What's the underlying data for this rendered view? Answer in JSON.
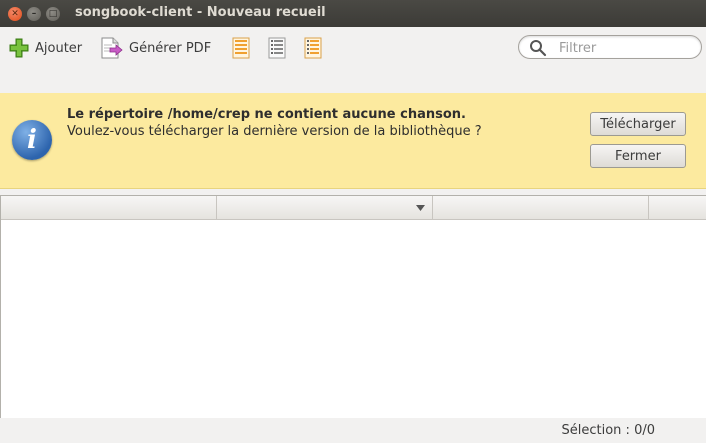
{
  "window": {
    "title": "songbook-client - Nouveau recueil"
  },
  "toolbar": {
    "add_label": "Ajouter",
    "pdf_label": "Générer PDF",
    "list_icons": [
      "list-orange-icon",
      "list-plain-icon",
      "list-mixed-icon"
    ]
  },
  "search": {
    "placeholder": "Filtrer",
    "value": ""
  },
  "infobar": {
    "title": "Le répertoire /home/crep ne contient aucune chanson.",
    "message": "Voulez-vous télécharger la dernière version de la bibliothèque ?",
    "download_label": "Télécharger",
    "close_label": "Fermer",
    "icon": "info-icon",
    "background_color": "#fcea9f"
  },
  "status": {
    "selection": "Sélection : 0/0"
  },
  "colors": {
    "titlebar": "#3c3b37",
    "close_button": "#df4a16",
    "info_blue": "#2d64ad"
  }
}
